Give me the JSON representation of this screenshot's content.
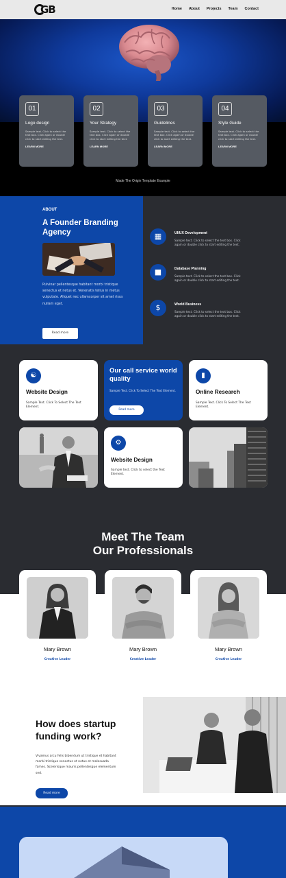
{
  "nav": {
    "logo": "GB",
    "items": [
      "Home",
      "About",
      "Projects",
      "Team",
      "Contact"
    ]
  },
  "features": [
    {
      "num": "01",
      "title": "Logo design",
      "text": "Sample text. Click to select the text box. Click again or double click to start editing the text.",
      "link": "LEARN MORE"
    },
    {
      "num": "02",
      "title": "Your Strategy",
      "text": "Sample text. Click to select the text box. Click again or double click to start editing the text.",
      "link": "LEARN MORE"
    },
    {
      "num": "03",
      "title": "Guidelines",
      "text": "Sample text. Click to select the text box. Click again or double click to start editing the text.",
      "link": "LEARN MORE"
    },
    {
      "num": "04",
      "title": "Style Guide",
      "text": "Sample text. Click to select the text box. Click again or double click to start editing the text.",
      "link": "LEARN MORE"
    }
  ],
  "made_by": "Made The Origin Template Example",
  "about": {
    "label": "ABOUT",
    "heading": "A Founder Branding Agency",
    "text": "Pulvinar pellentesque habitant morbi tristique senectus et netus et. Venenatis tellus in metus vulputate. Aliquet nec ullamcorper sit amet risus nullam eget.",
    "button": "Read more"
  },
  "services": [
    {
      "title": "UI/UX Development",
      "text": "Sample text. Click to select the text box. Click again or double click to start editing the text.",
      "icon": "briefcase-icon"
    },
    {
      "title": "Database Planning",
      "text": "Sample text. Click to select the text box. Click again or double click to start editing the text.",
      "icon": "building-icon"
    },
    {
      "title": "World Business",
      "text": "Sample text. Click to select the text box. Click again or double click to start editing the text.",
      "icon": "chat-dollar-icon"
    }
  ],
  "grid": {
    "card1": {
      "title": "Website Design",
      "text": "Sample Text. Click To Select The Text Element."
    },
    "blue": {
      "title": "Our call service world quality",
      "text": "Sample Text. Click To Select The Text Element.",
      "button": "Read more"
    },
    "card3": {
      "title": "Online Research",
      "text": "Sample Text. Click To Select The Text Element."
    },
    "card5": {
      "title": "Website Design",
      "text": "Sample text. Click to select the Text Element."
    }
  },
  "team": {
    "heading_line1": "Meet The Team",
    "heading_line2": "Our Professionals",
    "members": [
      {
        "name": "Mary Brown",
        "role": "Creative Leader"
      },
      {
        "name": "Mary Brown",
        "role": "Creative Leader"
      },
      {
        "name": "Mary Brown",
        "role": "Creative Leader"
      }
    ]
  },
  "funding": {
    "heading": "How does startup funding work?",
    "text": "Vivamus arcu felis bibendum ut tristique et habitant morbi tristique senectus et netus et malesuada fames. Scelerisque mauris pellentesque elementum sed.",
    "button": "Read more"
  },
  "colors": {
    "accent": "#0d47a8",
    "dark": "#2a2c31",
    "card": "#555a62"
  }
}
